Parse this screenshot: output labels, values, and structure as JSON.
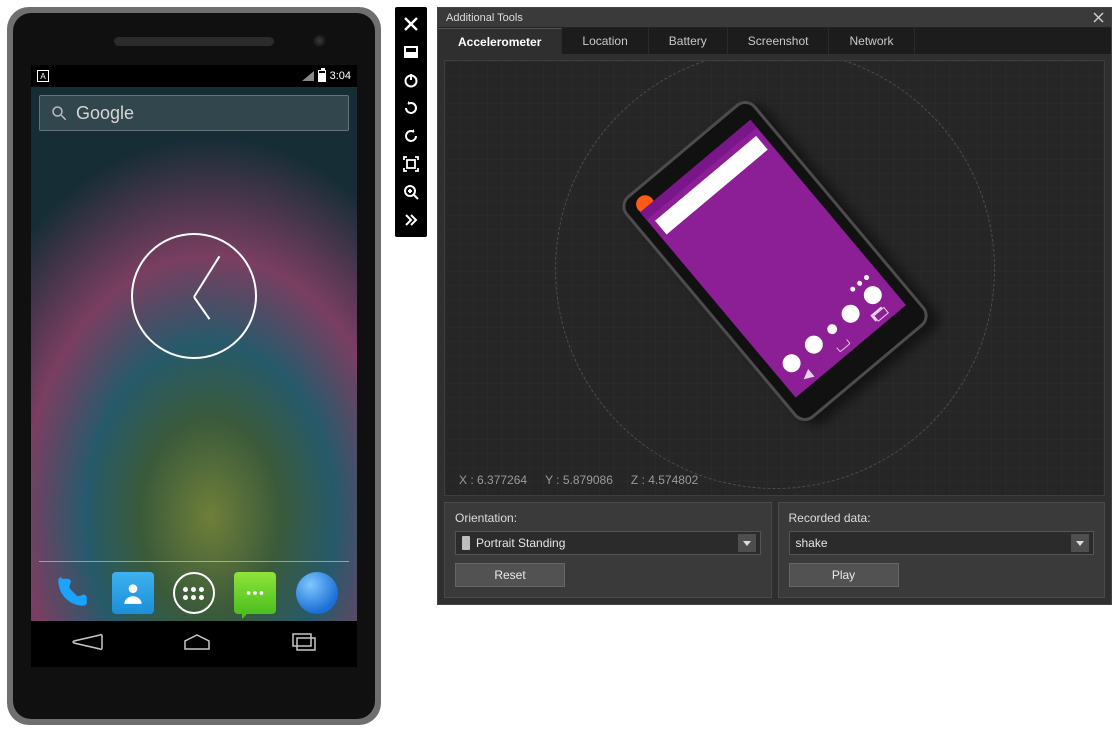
{
  "phone": {
    "status": {
      "badge": "A",
      "time": "3:04"
    },
    "search_placeholder": "Google"
  },
  "toolbar": {
    "items": [
      {
        "name": "close-icon"
      },
      {
        "name": "minimize-icon"
      },
      {
        "name": "power-icon"
      },
      {
        "name": "rotate-ccw-icon"
      },
      {
        "name": "rotate-cw-icon"
      },
      {
        "name": "fit-screen-icon"
      },
      {
        "name": "zoom-in-icon"
      },
      {
        "name": "more-icon"
      }
    ]
  },
  "panel": {
    "title": "Additional Tools",
    "tabs": [
      "Accelerometer",
      "Location",
      "Battery",
      "Screenshot",
      "Network"
    ],
    "active_tab": "Accelerometer",
    "coords": {
      "x_label": "X : 6.377264",
      "y_label": "Y : 5.879086",
      "z_label": "Z : 4.574802"
    },
    "orientation": {
      "label": "Orientation:",
      "selected": "Portrait Standing",
      "reset_label": "Reset"
    },
    "recorded": {
      "label": "Recorded data:",
      "selected": "shake",
      "play_label": "Play"
    }
  }
}
